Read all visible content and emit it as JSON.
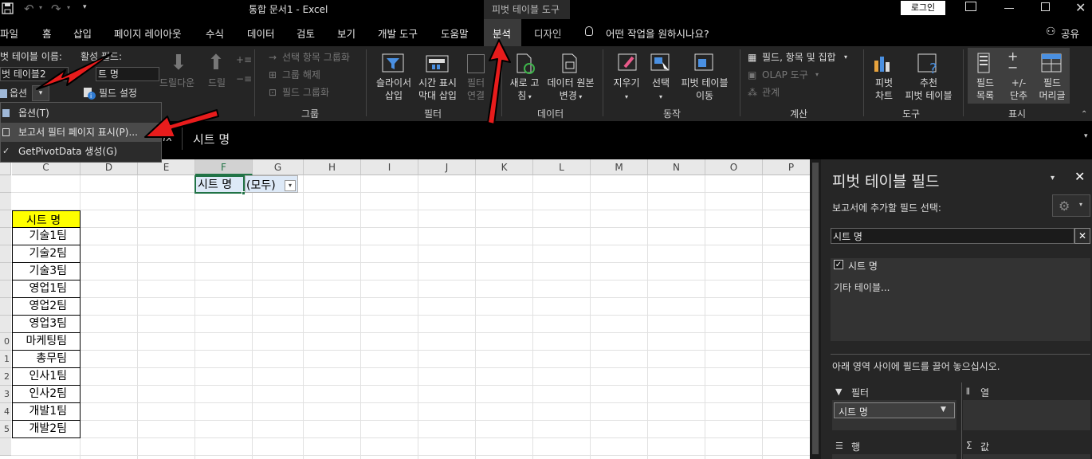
{
  "title_bar": {
    "doc_title": "통합 문서1  -  Excel",
    "context_group": "피벗 테이블 도구",
    "login": "로그인"
  },
  "tabs": [
    "파일",
    "홈",
    "삽입",
    "페이지 레이아웃",
    "수식",
    "데이터",
    "검토",
    "보기",
    "개발 도구",
    "도움말",
    "분석",
    "디자인"
  ],
  "active_tab": "분석",
  "tell_me": "어떤 작업을 원하시나요?",
  "share": "공유",
  "ribbon": {
    "pivot_name_label": "벗 테이블 이름:",
    "pivot_name_value": "벗 테이블2",
    "options_button": "옵션",
    "active_field_label": "활성 필드:",
    "active_field_value": "트 명",
    "field_settings": "필드 설정",
    "drill_down": "드릴다운",
    "drill_up": "드릴",
    "group_selection": "선택 항목 그룹화",
    "ungroup": "그룹 해제",
    "group_field": "필드 그룹화",
    "group_label": "그룹",
    "slicer": [
      "슬라이서",
      "삽입"
    ],
    "timeline": [
      "시간 표시",
      "막대 삽입"
    ],
    "filter_conn": [
      "필터",
      "연결"
    ],
    "filter_label": "필터",
    "refresh": [
      "새로 고",
      "침"
    ],
    "change_source": [
      "데이터 원본",
      "변경"
    ],
    "data_label": "데이터",
    "clear": "지우기",
    "select": "선택",
    "move_pivot": [
      "피벗 테이블",
      "이동"
    ],
    "actions_label": "동작",
    "fields_items_sets": "필드, 항목 및 집합",
    "olap_tools": "OLAP 도구",
    "relationships": "관계",
    "calc_label": "계산",
    "pivot_chart": [
      "피벗",
      "차트"
    ],
    "recommended": [
      "추천",
      "피벗 테이블"
    ],
    "tools_label": "도구",
    "field_list": [
      "필드",
      "목록"
    ],
    "plus_minus": [
      "+/-",
      "단추"
    ],
    "field_headers": [
      "필드",
      "머리글"
    ],
    "show_label": "표시"
  },
  "options_menu": {
    "items": [
      "옵션(T)",
      "보고서 필터 페이지 표시(P)...",
      "GetPivotData 생성(G)"
    ]
  },
  "formula": {
    "fx": "fx",
    "content": "시트 명"
  },
  "sheet": {
    "columns": [
      "C",
      "D",
      "E",
      "F",
      "G",
      "H",
      "I",
      "J",
      "K",
      "L",
      "M",
      "N",
      "O",
      "P"
    ],
    "row_numbers": [
      "",
      "",
      "",
      "",
      "",
      "",
      "",
      "",
      "",
      "0",
      "1",
      "2",
      "3",
      "4",
      "5"
    ],
    "filter_label": "시트 명",
    "filter_value": "(모두)",
    "table_header": "시트 명",
    "table_rows": [
      "기술1팀",
      "기술2팀",
      "기술3팀",
      "영업1팀",
      "영업2팀",
      "영업3팀",
      "마케팅팀",
      "총무팀",
      "인사1팀",
      "인사2팀",
      "개발1팀",
      "개발2팀"
    ]
  },
  "field_pane": {
    "title": "피벗 테이블 필드",
    "choose_label": "보고서에 추가할 필드 선택:",
    "search_value": "시트 명",
    "field_item": "시트 명",
    "more_tables": "기타 테이블...",
    "drag_hint": "아래 영역 사이에 필드를 끌어 놓으십시오.",
    "filters_label": "필터",
    "columns_label": "열",
    "filter_chip": "시트 명",
    "rows_label": "행",
    "values_label": "값"
  },
  "colors": {
    "accent_tab": "#3a3a3a",
    "header_fill": "#ffff00",
    "arrow": "#e81c1c"
  }
}
